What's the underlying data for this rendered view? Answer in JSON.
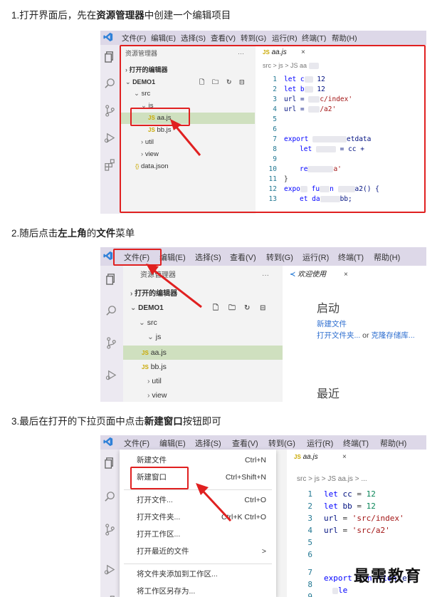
{
  "steps": {
    "s1_pre": "1.打开界面后，先在",
    "s1_bold": "资源管理器",
    "s1_post": "中创建一个编辑项目",
    "s2_pre": "2.随后点击",
    "s2_bold1": "左上角",
    "s2_mid": "的",
    "s2_bold2": "文件",
    "s2_post": "菜单",
    "s3_pre": "3.最后在打开的下拉页面中点击",
    "s3_bold": "新建窗口",
    "s3_post": "按钮即可"
  },
  "menu": {
    "file": "文件(F)",
    "edit": "编辑(E)",
    "select": "选择(S)",
    "view": "查看(V)",
    "goto": "转到(G)",
    "run": "运行(R)",
    "terminal": "终端(T)",
    "help": "帮助(H)"
  },
  "shot1": {
    "explorer_title": "资源管理器",
    "more": "···",
    "open_editors": "打开的编辑器",
    "project": "DEMO1",
    "src": "src",
    "js_folder": "js",
    "aa": "aa.js",
    "bb": "bb.js",
    "util": "util",
    "view_folder": "view",
    "datajson": "data.json",
    "tab": "aa.js",
    "crumb": "src > js > JS aa",
    "lines": [
      "1",
      "2",
      "3",
      "4",
      "5",
      "6",
      "7",
      "8",
      "9",
      "10",
      "11",
      "12",
      "13"
    ],
    "code": {
      "l1a": "let c",
      "l1b": "12",
      "l2a": "let b",
      "l2b": "12",
      "l3a": "url = ",
      "l3b": "c/index'",
      "l4a": "url = ",
      "l4b": "/a2'",
      "l7a": "export ",
      "l7b": "etdata",
      "l8a": "let ",
      "l8b": "= cc +",
      "l10a": "re",
      "l10b": "a'",
      "l11": "}",
      "l12a": "expo",
      "l12b": "fu",
      "l12c": "n",
      "l12d": "a2() {",
      "l13a": "et da",
      "l13b": "bb;"
    }
  },
  "shot2": {
    "explorer_title": "资源管理器",
    "more": "···",
    "open_editors": "打开的编辑器",
    "project": "DEMO1",
    "src": "src",
    "js_folder": "js",
    "aa": "aa.js",
    "bb": "bb.js",
    "util": "util",
    "view_folder": "view",
    "welcome_tab": "欢迎使用",
    "start": "启动",
    "new_file": "新建文件",
    "open_folder": "打开文件夹...",
    "or": " or ",
    "clone": "克隆存储库...",
    "recent": "最近"
  },
  "shot3": {
    "items": [
      {
        "label": "新建文件",
        "shortcut": "Ctrl+N"
      },
      {
        "label": "新建窗口",
        "shortcut": "Ctrl+Shift+N"
      },
      {
        "label": "打开文件...",
        "shortcut": "Ctrl+O"
      },
      {
        "label": "打开文件夹...",
        "shortcut": "Ctrl+K Ctrl+O"
      },
      {
        "label": "打开工作区...",
        "shortcut": ""
      },
      {
        "label": "打开最近的文件",
        "shortcut": ">"
      },
      {
        "label": "将文件夹添加到工作区...",
        "shortcut": ""
      },
      {
        "label": "将工作区另存为...",
        "shortcut": ""
      }
    ],
    "tab": "aa.js",
    "crumb": "src > js > JS aa.js > ...",
    "lines": [
      "1",
      "2",
      "3",
      "4",
      "5",
      "6",
      "7",
      "8",
      "9"
    ],
    "code": {
      "l1a": "let ",
      "l1b": "cc",
      "l1c": " = ",
      "l1d": "12",
      "l2a": "let ",
      "l2b": "bb",
      "l2c": " = ",
      "l2d": "12",
      "l3a": "url",
      "l3b": " = ",
      "l3c": "'src/index'",
      "l4a": "url",
      "l4b": " = ",
      "l4c": "'src/a2'",
      "l7a": "export ",
      "l7b": "un",
      "l7c": "tion",
      "l7d": "et",
      "l8": "le"
    }
  },
  "watermark": "最需教育",
  "colors": {
    "menubar": "#ddd8e8",
    "highlight_row": "#cfe0bf",
    "red_box": "#e02020",
    "vscode_blue": "#2f80d8"
  }
}
